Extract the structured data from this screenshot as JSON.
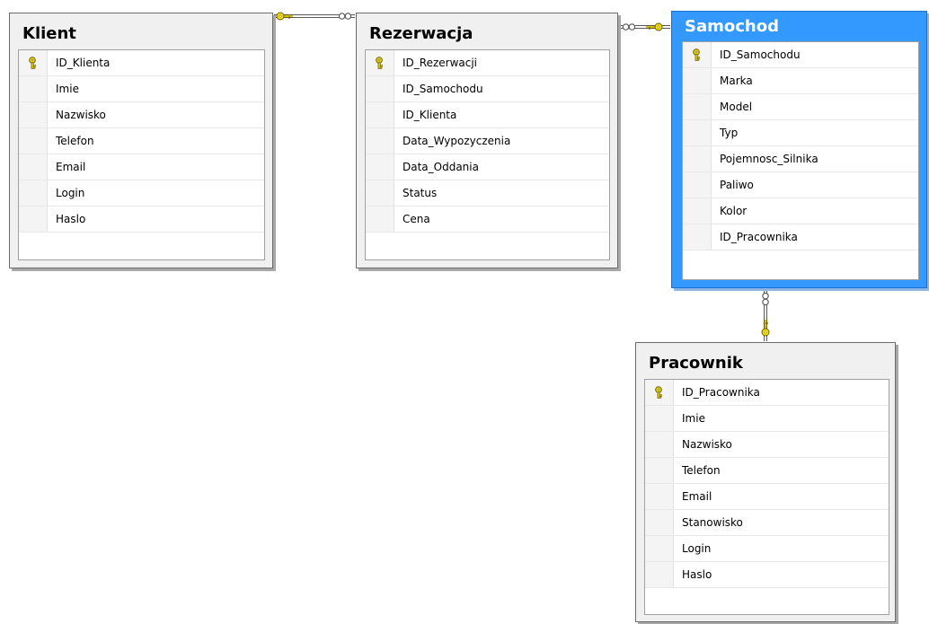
{
  "colors": {
    "table_background": "#f0f0f0",
    "selected_table_background": "#3399ff",
    "key_icon": "#f2e200",
    "relationship_line": "#5a5a5a"
  },
  "tables": [
    {
      "title": "Klient",
      "selected": false,
      "columns": [
        {
          "name": "ID_Klienta",
          "primary_key": true
        },
        {
          "name": "Imie",
          "primary_key": false
        },
        {
          "name": "Nazwisko",
          "primary_key": false
        },
        {
          "name": "Telefon",
          "primary_key": false
        },
        {
          "name": "Email",
          "primary_key": false
        },
        {
          "name": "Login",
          "primary_key": false
        },
        {
          "name": "Haslo",
          "primary_key": false
        }
      ]
    },
    {
      "title": "Rezerwacja",
      "selected": false,
      "columns": [
        {
          "name": "ID_Rezerwacji",
          "primary_key": true
        },
        {
          "name": "ID_Samochodu",
          "primary_key": false
        },
        {
          "name": "ID_Klienta",
          "primary_key": false
        },
        {
          "name": "Data_Wypozyczenia",
          "primary_key": false
        },
        {
          "name": "Data_Oddania",
          "primary_key": false
        },
        {
          "name": "Status",
          "primary_key": false
        },
        {
          "name": "Cena",
          "primary_key": false
        }
      ]
    },
    {
      "title": "Samochod",
      "selected": true,
      "columns": [
        {
          "name": "ID_Samochodu",
          "primary_key": true
        },
        {
          "name": "Marka",
          "primary_key": false
        },
        {
          "name": "Model",
          "primary_key": false
        },
        {
          "name": "Typ",
          "primary_key": false
        },
        {
          "name": "Pojemnosc_Silnika",
          "primary_key": false
        },
        {
          "name": "Paliwo",
          "primary_key": false
        },
        {
          "name": "Kolor",
          "primary_key": false
        },
        {
          "name": "ID_Pracownika",
          "primary_key": false
        }
      ]
    },
    {
      "title": "Pracownik",
      "selected": false,
      "columns": [
        {
          "name": "ID_Pracownika",
          "primary_key": true
        },
        {
          "name": "Imie",
          "primary_key": false
        },
        {
          "name": "Nazwisko",
          "primary_key": false
        },
        {
          "name": "Telefon",
          "primary_key": false
        },
        {
          "name": "Email",
          "primary_key": false
        },
        {
          "name": "Stanowisko",
          "primary_key": false
        },
        {
          "name": "Login",
          "primary_key": false
        },
        {
          "name": "Haslo",
          "primary_key": false
        }
      ]
    }
  ],
  "relationships": [
    {
      "from": "Klient",
      "to": "Rezerwacja",
      "one_side": "Klient",
      "many_side": "Rezerwacja"
    },
    {
      "from": "Samochod",
      "to": "Rezerwacja",
      "one_side": "Samochod",
      "many_side": "Rezerwacja"
    },
    {
      "from": "Pracownik",
      "to": "Samochod",
      "one_side": "Pracownik",
      "many_side": "Samochod"
    }
  ]
}
